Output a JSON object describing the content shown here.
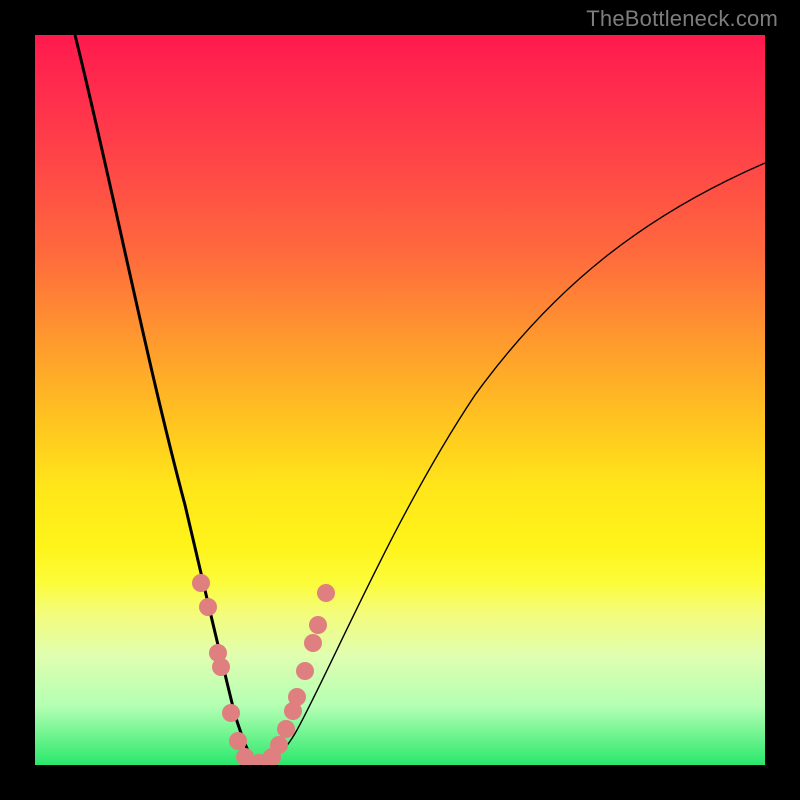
{
  "watermark": "TheBottleneck.com",
  "chart_data": {
    "type": "line",
    "title": "",
    "xlabel": "",
    "ylabel": "",
    "xlim": [
      0,
      100
    ],
    "ylim": [
      0,
      100
    ],
    "grid": false,
    "legend": false,
    "background_gradient": [
      "#ff1a4d",
      "#ffe61a",
      "#29e86b"
    ],
    "series": [
      {
        "name": "bottleneck-curve",
        "x": [
          5,
          10,
          15,
          20,
          23,
          25,
          27,
          29,
          30,
          32,
          34,
          36,
          40,
          50,
          60,
          70,
          80,
          90,
          100
        ],
        "y": [
          100,
          80,
          58,
          38,
          24,
          14,
          6,
          1,
          0,
          0,
          2,
          6,
          14,
          34,
          52,
          64,
          73,
          79,
          83
        ],
        "stroke": "#000000",
        "stroke_width_left": 3,
        "stroke_width_right": 1.3
      },
      {
        "name": "dot-markers-left",
        "type": "scatter",
        "x": [
          22.5,
          23.8,
          25.0,
          25.3,
          26.8,
          28.0,
          29.0,
          30.5
        ],
        "y": [
          25,
          22,
          15,
          13,
          6,
          1,
          0,
          0
        ],
        "marker_color": "#e08080",
        "marker_radius": 8
      },
      {
        "name": "dot-markers-right",
        "type": "scatter",
        "x": [
          31.5,
          32.0,
          33.0,
          34.0,
          35.0,
          35.5,
          36.5,
          37.5,
          38.0,
          39.0
        ],
        "y": [
          0,
          1,
          3,
          6,
          9,
          11,
          15,
          19,
          22,
          27
        ],
        "marker_color": "#e08080",
        "marker_radius": 8
      }
    ]
  }
}
